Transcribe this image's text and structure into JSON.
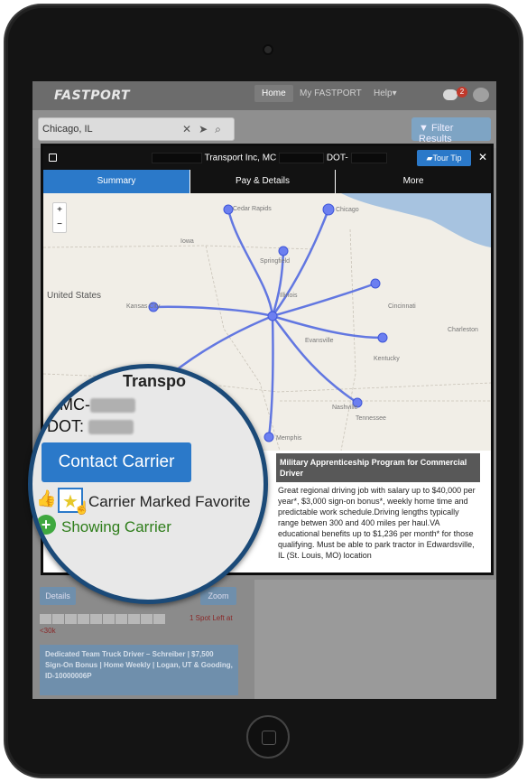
{
  "app": {
    "logo": "FASTPORT"
  },
  "nav": {
    "tabs": [
      "Home",
      "My FASTPORT",
      "Help"
    ],
    "notification_count": "2"
  },
  "search": {
    "value": "Chicago, IL",
    "filter_label": "Filter Results"
  },
  "modal": {
    "title_visible": "Transport Inc, MC",
    "dot_label": "DOT-",
    "tour_tip": "Tour Tip",
    "tabs": [
      "Summary",
      "Pay & Details",
      "More"
    ],
    "map": {
      "labels": [
        "Cedar Rapids",
        "Chicago",
        "United States",
        "Springfield",
        "Kansas City",
        "Charleston",
        "Cincinnati",
        "Evansville",
        "Kentucky",
        "Nashville",
        "Tennessee",
        "Memphis",
        "Iowa",
        "Illinois"
      ]
    },
    "job": {
      "title": "Military Apprenticeship Program for Commercial Driver",
      "description": "Great regional driving job with salary up to $40,000 per year*, $3,000 sign-on bonus*, weekly home time and predictable work schedule.Driving lengths typically range betwen 300 and 400 miles per haul.VA educational benefits up to $1,236 per month* for those qualifying. Must be able to park tractor in Edwardsville, IL (St. Louis, MO) location"
    }
  },
  "magnifier": {
    "name_partial": "Transpo",
    "mc_label": "MC-",
    "dot_label": "DOT:",
    "contact_button": "Contact Carrier",
    "favorite_text": "Carrier Marked Favorite",
    "showing_text": "Showing Carrier"
  },
  "listing": {
    "details_button": "Details",
    "zoom_button": "Zoom",
    "spot_left": "1 Spot Left at",
    "spot_left2": "<30k",
    "job_link": "Dedicated Team Truck Driver – Schreiber | $7,500 Sign-On Bonus | Home Weekly | Logan, UT & Gooding, ID-10000006P"
  },
  "colors": {
    "accent": "#2b79c9",
    "magnifier_ring": "#1b4a78",
    "favorite_star": "#e6c82b",
    "showing_green": "#2e7d1a"
  }
}
